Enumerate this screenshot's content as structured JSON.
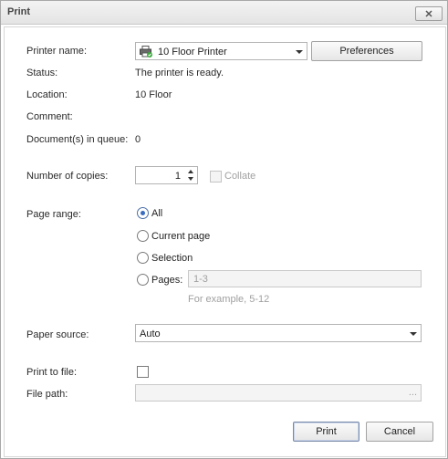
{
  "window": {
    "title": "Print"
  },
  "printer": {
    "name_label": "Printer name:",
    "selected": "10 Floor Printer",
    "preferences_label": "Preferences",
    "status_label": "Status:",
    "status_value": "The printer is ready.",
    "location_label": "Location:",
    "location_value": "10 Floor",
    "comment_label": "Comment:",
    "comment_value": "",
    "queue_label": "Document(s) in queue:",
    "queue_value": "0"
  },
  "copies": {
    "label": "Number of copies:",
    "value": "1",
    "collate_label": "Collate"
  },
  "page_range": {
    "label": "Page range:",
    "all_label": "All",
    "current_label": "Current page",
    "selection_label": "Selection",
    "pages_label": "Pages:",
    "pages_placeholder": "1-3",
    "example_text": "For example, 5-12",
    "selected": "All"
  },
  "paper_source": {
    "label": "Paper source:",
    "selected": "Auto"
  },
  "print_to_file": {
    "label": "Print to file:",
    "file_path_label": "File path:",
    "ellipsis": "..."
  },
  "actions": {
    "print_label": "Print",
    "cancel_label": "Cancel"
  },
  "icons": {
    "printer_status_color": "#3aa83a"
  }
}
